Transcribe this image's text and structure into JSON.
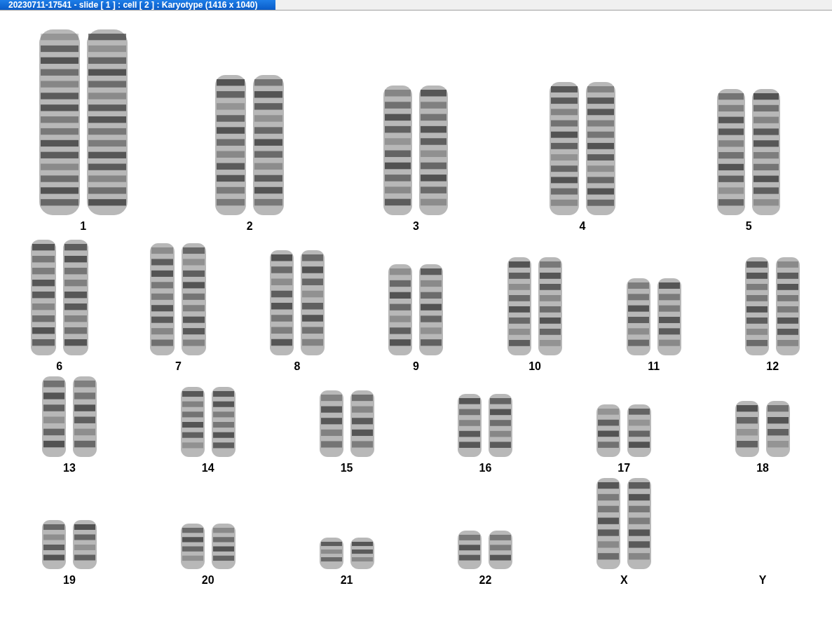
{
  "window": {
    "title": "20230711-17541 - slide [ 1 ] : cell [ 2 ] : Karyotype  (1416 x 1040)"
  },
  "karyotype": {
    "rows": [
      {
        "groups": [
          {
            "label": "1"
          },
          {
            "label": "2"
          },
          {
            "label": "3"
          },
          {
            "label": "4"
          },
          {
            "label": "5"
          }
        ]
      },
      {
        "groups": [
          {
            "label": "6"
          },
          {
            "label": "7"
          },
          {
            "label": "8"
          },
          {
            "label": "9"
          },
          {
            "label": "10"
          },
          {
            "label": "11"
          },
          {
            "label": "12"
          }
        ]
      },
      {
        "groups": [
          {
            "label": "13"
          },
          {
            "label": "14"
          },
          {
            "label": "15"
          },
          {
            "label": "16"
          },
          {
            "label": "17"
          },
          {
            "label": "18"
          }
        ]
      },
      {
        "groups": [
          {
            "label": "19"
          },
          {
            "label": "20"
          },
          {
            "label": "21"
          },
          {
            "label": "22"
          },
          {
            "label": "X"
          },
          {
            "label": "Y"
          }
        ]
      }
    ]
  }
}
